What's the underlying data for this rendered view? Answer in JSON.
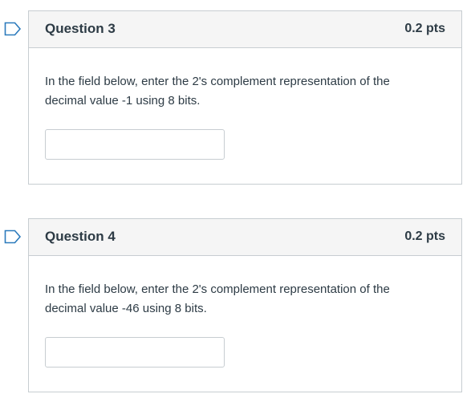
{
  "questions": [
    {
      "title": "Question 3",
      "points": "0.2 pts",
      "text": "In the field below, enter the 2's complement representation of the decimal value -1 using 8 bits.",
      "answer_value": ""
    },
    {
      "title": "Question 4",
      "points": "0.2 pts",
      "text": "In the field below, enter the 2's complement representation of the decimal value -46 using 8 bits.",
      "answer_value": ""
    }
  ],
  "icons": {
    "flag": "flag-question-icon"
  },
  "colors": {
    "flag": "#2b7abc",
    "header_bg": "#f5f5f5",
    "border": "#c7cdd1",
    "text": "#2d3b45"
  }
}
